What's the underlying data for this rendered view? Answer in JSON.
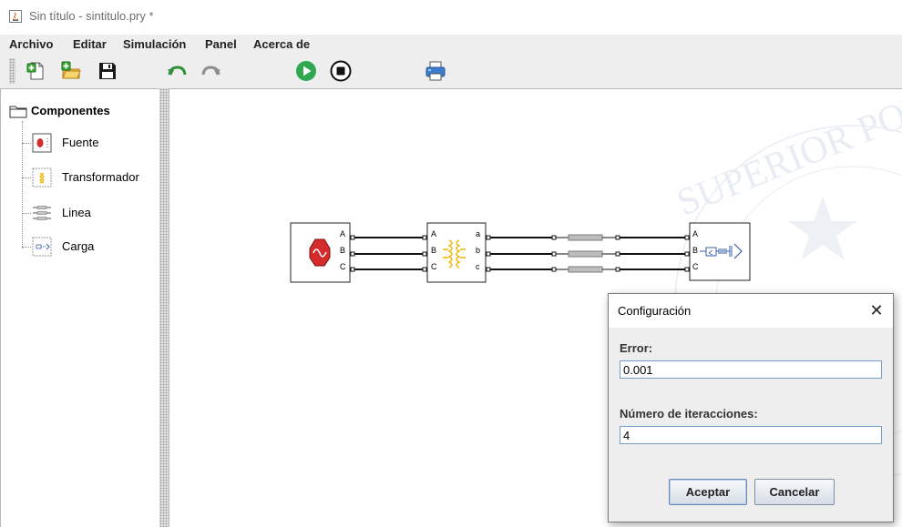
{
  "window": {
    "title": "Sin título - sintitulo.pry *"
  },
  "menubar": {
    "items": [
      "Archivo",
      "Editar",
      "Simulación",
      "Panel",
      "Acerca de"
    ]
  },
  "toolbar": {
    "icons": [
      "new-file-icon",
      "open-folder-icon",
      "save-icon",
      "undo-icon",
      "redo-icon",
      "run-simulation-icon",
      "stop-simulation-icon",
      "print-icon"
    ]
  },
  "components_tree": {
    "root_label": "Componentes",
    "items": [
      {
        "label": "Fuente",
        "icon": "source-icon"
      },
      {
        "label": "Transformador",
        "icon": "transformer-icon"
      },
      {
        "label": "Linea",
        "icon": "line-icon"
      },
      {
        "label": "Carga",
        "icon": "load-icon"
      }
    ]
  },
  "diagram": {
    "source_ports": [
      "A",
      "B",
      "C"
    ],
    "transformer_in_ports": [
      "A",
      "B",
      "C"
    ],
    "transformer_out_ports": [
      "a",
      "b",
      "c"
    ],
    "load_ports": [
      "A",
      "B",
      "C"
    ],
    "watermark": "SUPERIOR POLITÉ"
  },
  "dialog": {
    "title": "Configuración",
    "error_label": "Error:",
    "error_value": "0.001",
    "iterations_label": "Número de iteracciones:",
    "iterations_value": "4",
    "accept_label": "Aceptar",
    "cancel_label": "Cancelar"
  },
  "colors": {
    "source_red": "#d42c2c",
    "transformer_yellow": "#f2b400",
    "run_green": "#2fa84f",
    "line_gray": "#9b9b9b",
    "load_blue": "#3a5fa8"
  }
}
